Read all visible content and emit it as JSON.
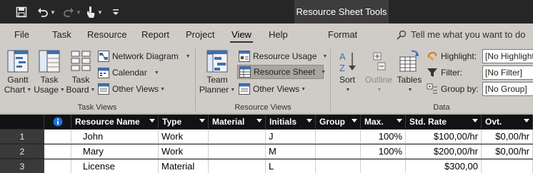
{
  "title_bar": {
    "contextual_tools_label": "Resource Sheet Tools"
  },
  "tabs": [
    {
      "label": "File"
    },
    {
      "label": "Task"
    },
    {
      "label": "Resource"
    },
    {
      "label": "Report"
    },
    {
      "label": "Project"
    },
    {
      "label": "View",
      "active": true
    },
    {
      "label": "Help"
    },
    {
      "label": "Format"
    }
  ],
  "tell_me": "Tell me what you want to do",
  "ribbon": {
    "task_views": {
      "label": "Task Views",
      "gantt_chart": {
        "line1": "Gantt",
        "line2": "Chart"
      },
      "task_usage": {
        "line1": "Task",
        "line2": "Usage"
      },
      "task_board": {
        "line1": "Task",
        "line2": "Board"
      },
      "network_diagram": "Network Diagram",
      "calendar": "Calendar",
      "other_views": "Other Views"
    },
    "resource_views": {
      "label": "Resource Views",
      "team_planner": {
        "line1": "Team",
        "line2": "Planner"
      },
      "resource_usage": "Resource Usage",
      "resource_sheet": "Resource Sheet",
      "other_views": "Other Views"
    },
    "data": {
      "label": "Data",
      "sort": "Sort",
      "outline": "Outline",
      "tables": "Tables",
      "highlight_label": "Highlight:",
      "highlight_value": "[No Highlight]",
      "filter_label": "Filter:",
      "filter_value": "[No Filter]",
      "group_by_label": "Group by:",
      "group_by_value": "[No Group]"
    }
  },
  "grid": {
    "columns": [
      "Resource Name",
      "Type",
      "Material",
      "Initials",
      "Group",
      "Max.",
      "Std. Rate",
      "Ovt."
    ],
    "rows": [
      {
        "num": "1",
        "name": "John",
        "type": "Work",
        "material": "",
        "initials": "J",
        "group": "",
        "max": "100%",
        "std_rate": "$100,00/hr",
        "ovt": "$0,00/hr"
      },
      {
        "num": "2",
        "name": "Mary",
        "type": "Work",
        "material": "",
        "initials": "M",
        "group": "",
        "max": "100%",
        "std_rate": "$200,00/hr",
        "ovt": "$0,00/hr"
      },
      {
        "num": "3",
        "name": "License",
        "type": "Material",
        "material": "",
        "initials": "L",
        "group": "",
        "max": "",
        "std_rate": "$300,00",
        "ovt": ""
      }
    ]
  },
  "colors": {
    "title_bar": "#262626",
    "ribbon": "#cfcbc6",
    "grid_header": "#121212",
    "info_icon": "#1e6fd9"
  }
}
